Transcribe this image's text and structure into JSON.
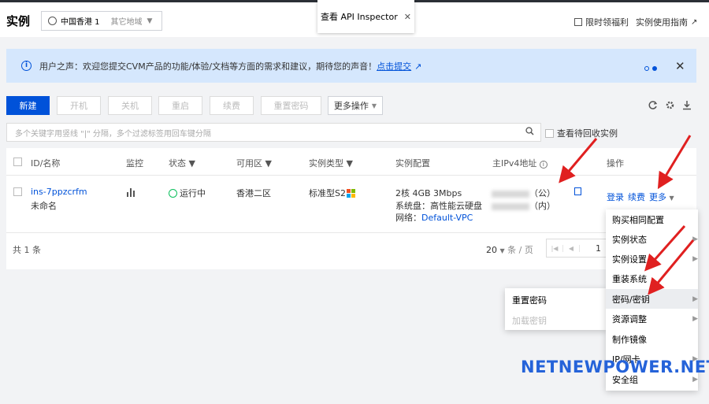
{
  "header": {
    "title": "实例",
    "region_current": "中国香港 1",
    "region_other": "其它地域",
    "inspector_label": "查看 API Inspector",
    "limited_offer": "限时领福利",
    "usage_guide": "实例使用指南"
  },
  "banner": {
    "message": "用户之声：欢迎您提交CVM产品的功能/体验/文档等方面的需求和建议，期待您的声音！",
    "link": "点击提交"
  },
  "toolbar": {
    "new": "新建",
    "start": "开机",
    "stop": "关机",
    "restart": "重启",
    "renew": "续费",
    "reset_password": "重置密码",
    "more_actions": "更多操作"
  },
  "search": {
    "placeholder": "多个关键字用竖线 \"|\" 分隔，多个过滤标签用回车键分隔",
    "recycle_label": "查看待回收实例"
  },
  "table": {
    "headers": {
      "id_name": "ID/名称",
      "monitor": "监控",
      "status": "状态",
      "zone": "可用区",
      "type": "实例类型",
      "config": "实例配置",
      "ipv4": "主IPv4地址",
      "actions": "操作"
    },
    "row": {
      "id": "ins-7ppzcrfm",
      "name": "未命名",
      "status": "运行中",
      "zone": "香港二区",
      "type": "标准型S2",
      "config_line1": "2核 4GB 3Mbps",
      "config_line2": "系统盘：高性能云硬盘",
      "config_line3_label": "网络：",
      "config_line3_value": "Default-VPC",
      "ip_public_suffix": "（公）",
      "ip_private_suffix": "（内）",
      "action_login": "登录",
      "action_renew": "续费",
      "action_more": "更多"
    },
    "footer": {
      "total": "共 1 条",
      "page_size": "20",
      "page_size_unit": "条 / 页",
      "page_number": "1"
    }
  },
  "more_menu": [
    {
      "label": "购买相同配置",
      "has_submenu": false
    },
    {
      "label": "实例状态",
      "has_submenu": true
    },
    {
      "label": "实例设置",
      "has_submenu": true
    },
    {
      "label": "重装系统",
      "has_submenu": false
    },
    {
      "label": "密码/密钥",
      "has_submenu": true
    },
    {
      "label": "资源调整",
      "has_submenu": true
    },
    {
      "label": "制作镜像",
      "has_submenu": false
    },
    {
      "label": "IP/网卡",
      "has_submenu": true
    },
    {
      "label": "安全组",
      "has_submenu": true
    }
  ],
  "submenu": {
    "reset_password": "重置密码",
    "load_key": "加载密钥"
  },
  "watermark": "NETNEWPOWER.NET",
  "colors": {
    "primary": "#0052d9",
    "banner_bg": "#d5e7fd",
    "running": "#0abf5b",
    "arrow": "#e02020"
  }
}
